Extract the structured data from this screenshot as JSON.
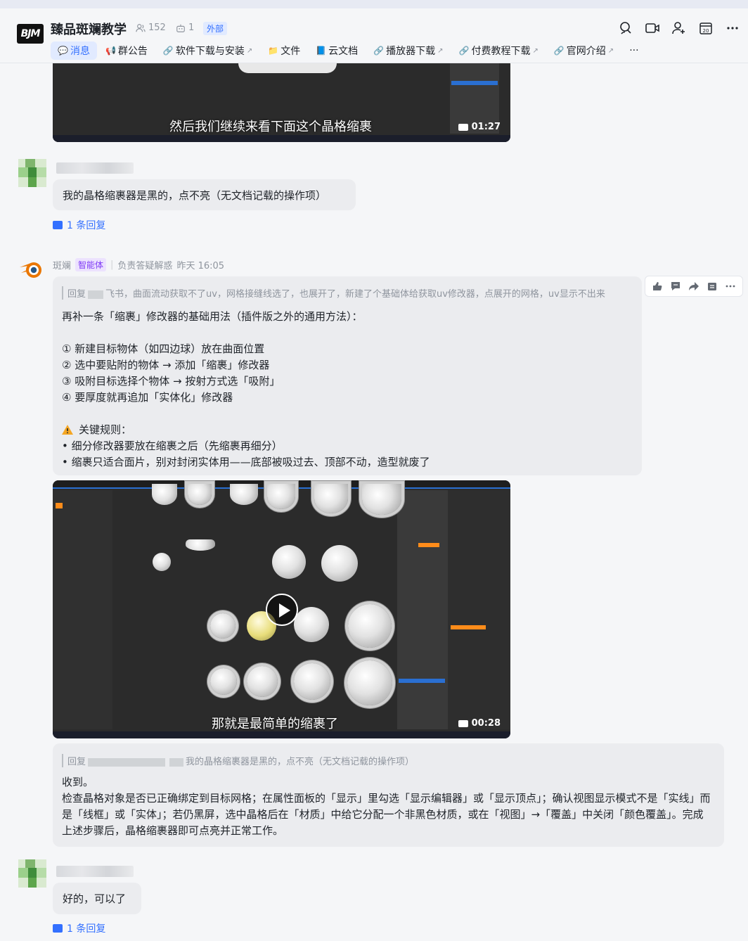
{
  "header": {
    "logo_text": "BJM",
    "group_name": "臻品斑斓教学",
    "member_count": "152",
    "bot_count": "1",
    "external_tag": "外部",
    "tabs": [
      {
        "label": "消息",
        "icon": "chat-icon",
        "active": true,
        "external": false
      },
      {
        "label": "群公告",
        "icon": "megaphone-icon",
        "active": false,
        "external": false
      },
      {
        "label": "软件下载与安装",
        "icon": "link-icon",
        "active": false,
        "external": true
      },
      {
        "label": "文件",
        "icon": "folder-icon",
        "active": false,
        "external": false
      },
      {
        "label": "云文档",
        "icon": "doc-icon",
        "active": false,
        "external": false
      },
      {
        "label": "播放器下载",
        "icon": "link-icon",
        "active": false,
        "external": true
      },
      {
        "label": "付费教程下载",
        "icon": "link-icon",
        "active": false,
        "external": true
      },
      {
        "label": "官网介绍",
        "icon": "link-icon",
        "active": false,
        "external": true
      },
      {
        "label": "···",
        "icon": "more-icon",
        "active": false,
        "external": false
      }
    ],
    "header_icons": [
      "search-icon",
      "video-call-icon",
      "add-member-icon",
      "calendar-icon",
      "more-icon"
    ],
    "calendar_day": "20"
  },
  "messages": {
    "video1": {
      "subtitle": "然后我们继续来看下面这个晶格缩裹",
      "duration": "01:27"
    },
    "user_msg1": {
      "text": "我的晶格缩裹器是黑的，点不亮（无文档记载的操作项）",
      "reply_link": "1 条回复"
    },
    "bot": {
      "name": "斑斓",
      "badge": "智能体",
      "role": "负责答疑解惑",
      "time": "昨天 16:05",
      "quote_prefix": "回复",
      "quote_text": "飞书，曲面流动获取不了uv，网格接缝线选了，也展开了，新建了个基础体给获取uv修改器，点展开的网格，uv显示不出来",
      "intro": "再补一条「缩裹」修改器的基础用法（插件版之外的通用方法）：",
      "steps": [
        "① 新建目标物体（如四边球）放在曲面位置",
        "② 选中要贴附的物体 → 添加「缩裹」修改器",
        "③ 吸附目标选择个物体 → 按射方式选「吸附」",
        "④ 要厚度就再追加「实体化」修改器"
      ],
      "warning_title": "关键规则：",
      "rules": [
        "• 细分修改器要放在缩裹之后（先缩裹再细分）",
        "• 缩裹只适合面片，别对封闭实体用——底部被吸过去、顶部不动，造型就废了"
      ]
    },
    "video2": {
      "subtitle": "那就是最简单的缩裹了",
      "duration": "00:28"
    },
    "bot_reply": {
      "quote_prefix": "回复",
      "quote_text": "我的晶格缩裹器是黑的，点不亮（无文档记载的操作项）",
      "line1": "收到。",
      "line2": "检查晶格对象是否已正确绑定到目标网格；在属性面板的「显示」里勾选「显示编辑器」或「显示顶点」；确认视图显示模式不是「实线」而是「线框」或「实体」；若仍黑屏，选中晶格后在「材质」中给它分配一个非黑色材质，或在「视图」→「覆盖」中关闭「颜色覆盖」。完成上述步骤后，晶格缩裹器即可点亮并正常工作。"
    },
    "user_msg2": {
      "text": "好的，可以了",
      "reply_link": "1 条回复"
    }
  }
}
